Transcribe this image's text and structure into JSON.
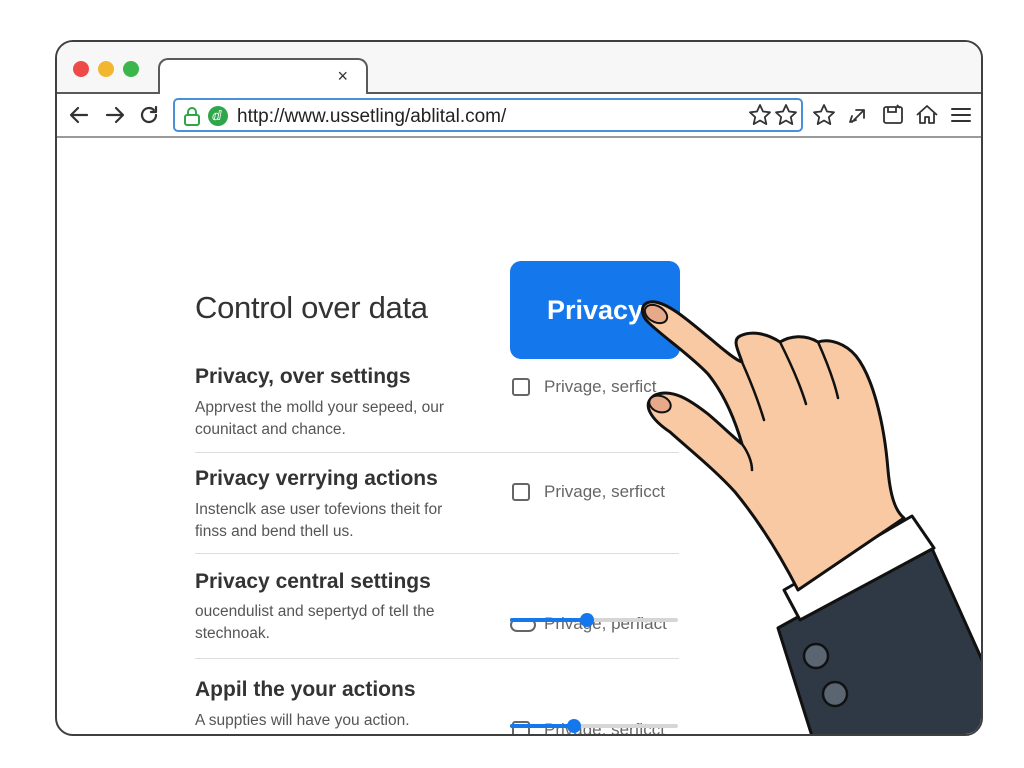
{
  "browser": {
    "url": "http://www.ussetling/ablital.com/",
    "tab_close": "×"
  },
  "page": {
    "heading": "Control over data",
    "privacy_button": "Privacy",
    "accent_color": "#1577ec",
    "rows": [
      {
        "title": "Privacy, over settings",
        "desc_line1": "Apprvest the molld your sepeed, our",
        "desc_line2": "counitact and chance.",
        "control": "checkbox",
        "option_label": "Privage, serfict"
      },
      {
        "title": "Privacy verrying actions",
        "desc_line1": "Instenclk ase user tofevions theit for",
        "desc_line2": "finss and bend thell us.",
        "control": "checkbox",
        "option_label": "Privage, serficct"
      },
      {
        "title": "Privacy central settings",
        "desc_line1": "oucendulist and sepertyd of tell the",
        "desc_line2": "stechnoak.",
        "control": "toggle",
        "option_label": "Privage, perfiact",
        "slider_value": 0.46
      },
      {
        "title": "Appil the your actions",
        "desc_line1": "A suppties will have you action.",
        "desc_line2": "",
        "control": "checkbox",
        "option_label": "Privage, serficct",
        "slider_value": 0.38
      }
    ]
  }
}
